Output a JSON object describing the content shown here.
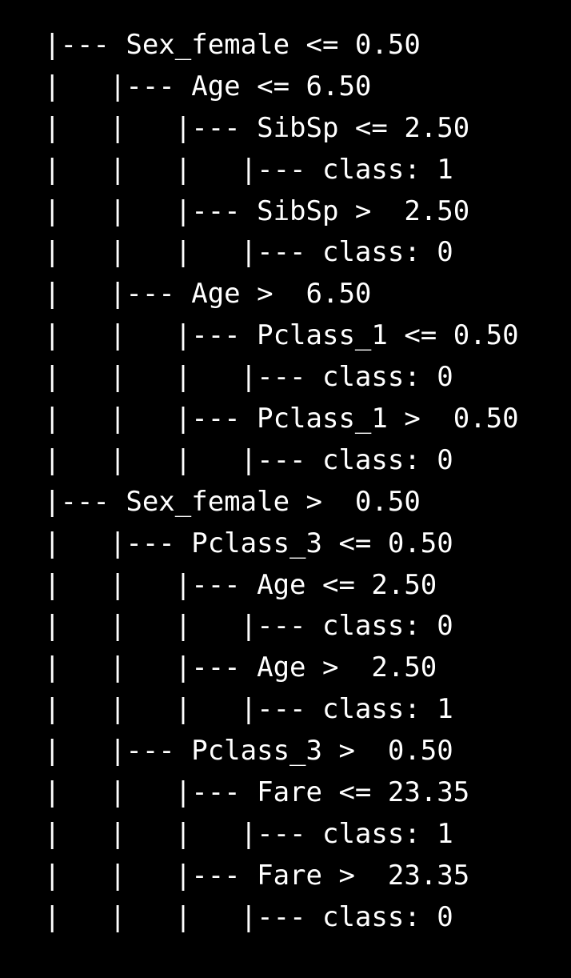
{
  "terminal": {
    "background_color": "#000000",
    "text_color": "#ffffff",
    "lines": [
      "|--- Sex_female <= 0.50",
      "|   |--- Age <= 6.50",
      "|   |   |--- SibSp <= 2.50",
      "|   |   |   |--- class: 1",
      "|   |   |--- SibSp >  2.50",
      "|   |   |   |--- class: 0",
      "|   |--- Age >  6.50",
      "|   |   |--- Pclass_1 <= 0.50",
      "|   |   |   |--- class: 0",
      "|   |   |--- Pclass_1 >  0.50",
      "|   |   |   |--- class: 0",
      "|--- Sex_female >  0.50",
      "|   |--- Pclass_3 <= 0.50",
      "|   |   |--- Age <= 2.50",
      "|   |   |   |--- class: 0",
      "|   |   |--- Age >  2.50",
      "|   |   |   |--- class: 1",
      "|   |--- Pclass_3 >  0.50",
      "|   |   |--- Fare <= 23.35",
      "|   |   |   |--- class: 1",
      "|   |   |--- Fare >  23.35",
      "|   |   |   |--- class: 0"
    ]
  }
}
